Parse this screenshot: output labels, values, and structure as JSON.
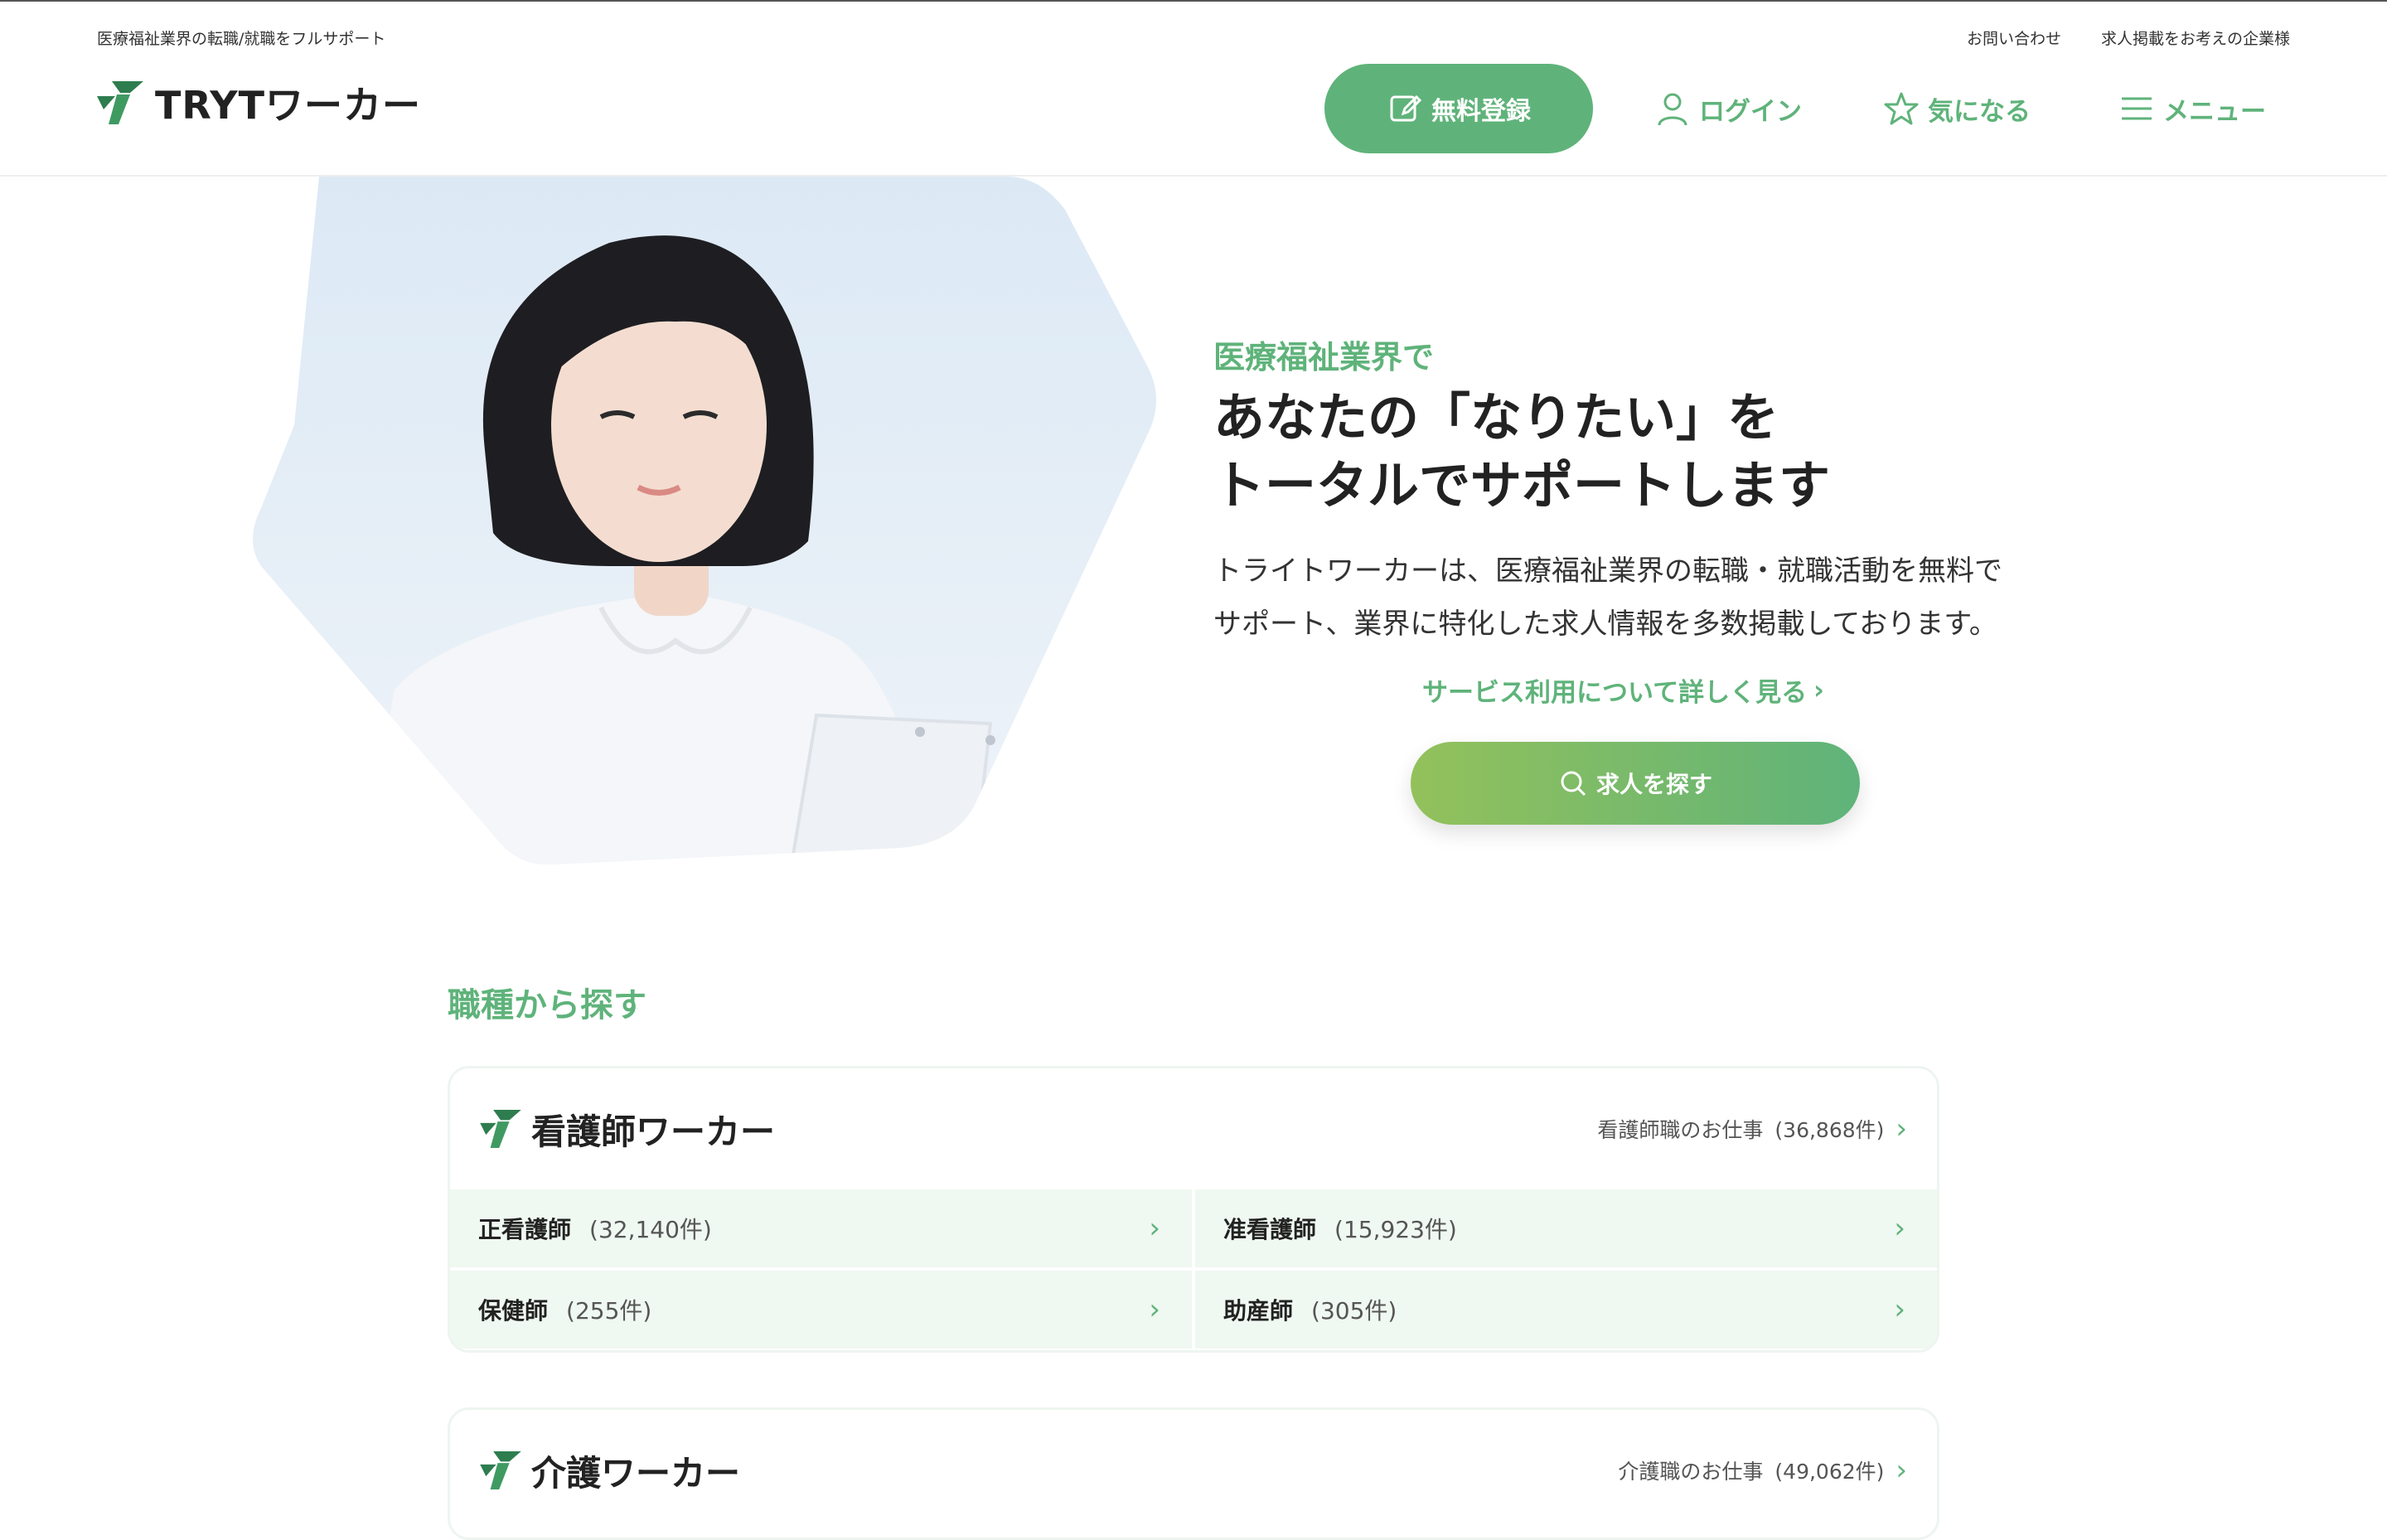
{
  "header": {
    "tagline": "医療福祉業界の転職/就職をフルサポート",
    "util_links": [
      "お問い合わせ",
      "求人掲載をお考えの企業様"
    ],
    "logo_text": "TRYTワーカー",
    "register_label": "無料登録",
    "login_label": "ログイン",
    "favorite_label": "気になる",
    "menu_label": "メニュー"
  },
  "hero": {
    "kicker": "医療福祉業界で",
    "title_line1": "あなたの「なりたい」を",
    "title_line2": "トータルでサポートします",
    "desc_line1": "トライトワーカーは、医療福祉業界の転職・就職活動を無料で",
    "desc_line2": "サポート、業界に特化した求人情報を多数掲載しております。",
    "link_label": "サービス利用について詳しく見る",
    "search_label": "求人を探す"
  },
  "jobs": {
    "section_title": "職種から探す",
    "nurse": {
      "title": "看護師ワーカー",
      "count_label": "看護師職のお仕事",
      "count": "(36,868件)",
      "items": [
        {
          "name": "正看護師",
          "count": "(32,140件)"
        },
        {
          "name": "准看護師",
          "count": "(15,923件)"
        },
        {
          "name": "保健師",
          "count": "(255件)"
        },
        {
          "name": "助産師",
          "count": "(305件)"
        }
      ]
    },
    "care": {
      "title": "介護ワーカー",
      "count_label": "介護職のお仕事",
      "count": "(49,062件)"
    }
  },
  "colors": {
    "accent": "#5fb37a",
    "accent_light": "#93c15b",
    "cell_bg": "#eff8f1"
  }
}
